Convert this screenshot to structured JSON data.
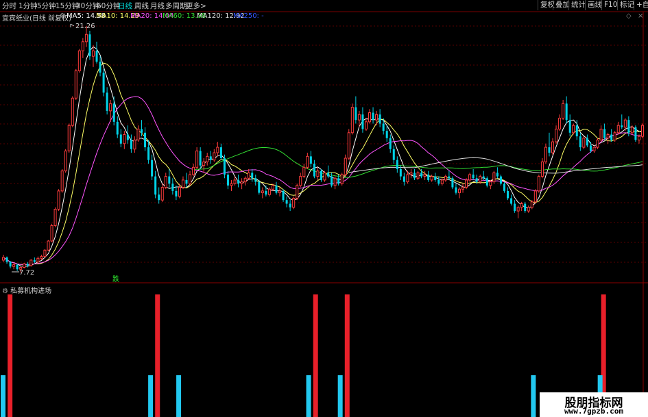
{
  "toolbar": {
    "timeframes": [
      "分时",
      "1分钟",
      "5分钟",
      "15分钟",
      "30分钟",
      "60分钟",
      "日线",
      "周线",
      "月线",
      "多周期",
      "更多>"
    ],
    "active_timeframe": "日线",
    "right_buttons": [
      "复权",
      "叠加",
      "统计",
      "画线",
      "F10",
      "标记",
      "+自选"
    ]
  },
  "stock_info": {
    "name": "宜宾纸业(日线 前复权)",
    "ma5": "MA5: 14.58",
    "ma10": "MA10: 14.29",
    "ma20": "MA20: 14.04",
    "ma60": "MA60: 13.08",
    "ma120": "MA120: 12.92",
    "ma250": "MA250: -"
  },
  "colors": {
    "up": "#ff3c3c",
    "down": "#00d2e6",
    "ma5": "#ffffff",
    "ma10": "#ffff66",
    "ma20": "#ff55ff",
    "ma60": "#33dd33",
    "ma120": "#e0e0e0",
    "ma250": "#3355ff",
    "grid": "#5a0000",
    "indicator_red": "#e8202a",
    "indicator_cyan": "#22c8f0"
  },
  "annotations": {
    "high_label": "21.26",
    "low_label": "7.72",
    "signal_text": "跌"
  },
  "indicator": {
    "title": "私募机构进场",
    "red_bar_indices": [
      1,
      43,
      88,
      97,
      170
    ],
    "cyan_bar_indices": [
      0,
      42,
      50,
      87,
      96,
      151,
      170
    ]
  },
  "watermark": {
    "title": "股朋指标网",
    "url": "www.7gpzb.com"
  },
  "chart_data": {
    "type": "candlestick",
    "y_range": [
      7.72,
      21.26
    ],
    "high_marker_index": 24,
    "low_marker_index": 5,
    "ohlc": [
      [
        8.4,
        8.7,
        8.3,
        8.55
      ],
      [
        8.55,
        8.6,
        8.2,
        8.3
      ],
      [
        8.3,
        8.35,
        7.95,
        8.05
      ],
      [
        8.05,
        8.25,
        7.9,
        8.15
      ],
      [
        8.15,
        8.2,
        7.8,
        7.9
      ],
      [
        7.9,
        8.05,
        7.72,
        8.0
      ],
      [
        8.0,
        8.25,
        7.95,
        8.2
      ],
      [
        8.2,
        8.3,
        8.0,
        8.1
      ],
      [
        8.1,
        8.45,
        8.05,
        8.4
      ],
      [
        8.4,
        8.55,
        8.25,
        8.3
      ],
      [
        8.3,
        8.6,
        8.2,
        8.5
      ],
      [
        8.5,
        8.7,
        8.4,
        8.6
      ],
      [
        8.6,
        9.0,
        8.55,
        8.95
      ],
      [
        8.95,
        9.5,
        8.9,
        9.45
      ],
      [
        9.45,
        10.4,
        9.4,
        10.3
      ],
      [
        10.3,
        11.3,
        10.2,
        11.2
      ],
      [
        11.2,
        12.3,
        11.1,
        12.2
      ],
      [
        12.2,
        13.4,
        12.1,
        13.3
      ],
      [
        13.3,
        14.5,
        13.2,
        14.4
      ],
      [
        14.4,
        15.9,
        14.3,
        15.8
      ],
      [
        15.8,
        17.4,
        15.7,
        17.3
      ],
      [
        17.3,
        18.9,
        17.2,
        18.8
      ],
      [
        18.8,
        20.0,
        18.7,
        19.9
      ],
      [
        19.9,
        20.6,
        19.5,
        20.4
      ],
      [
        20.4,
        21.26,
        20.1,
        20.8
      ],
      [
        20.8,
        21.0,
        19.4,
        19.6
      ],
      [
        19.6,
        20.2,
        19.0,
        19.9
      ],
      [
        19.9,
        20.4,
        19.2,
        19.3
      ],
      [
        19.3,
        19.6,
        18.5,
        18.7
      ],
      [
        18.7,
        18.9,
        17.4,
        17.6
      ],
      [
        17.6,
        17.9,
        16.4,
        16.6
      ],
      [
        16.6,
        17.2,
        16.0,
        17.0
      ],
      [
        17.0,
        17.4,
        15.8,
        16.0
      ],
      [
        16.0,
        16.3,
        15.1,
        15.3
      ],
      [
        15.3,
        15.6,
        14.6,
        14.8
      ],
      [
        14.8,
        15.5,
        14.5,
        15.3
      ],
      [
        15.3,
        15.8,
        14.8,
        15.0
      ],
      [
        15.0,
        15.3,
        14.3,
        14.5
      ],
      [
        14.5,
        15.2,
        14.3,
        15.0
      ],
      [
        15.0,
        15.8,
        14.9,
        15.6
      ],
      [
        15.6,
        16.1,
        15.2,
        15.4
      ],
      [
        15.4,
        15.7,
        14.4,
        14.6
      ],
      [
        14.6,
        15.0,
        13.7,
        13.9
      ],
      [
        13.9,
        14.2,
        12.8,
        13.0
      ],
      [
        13.0,
        13.3,
        11.8,
        12.0
      ],
      [
        12.0,
        12.4,
        11.5,
        11.7
      ],
      [
        11.7,
        12.6,
        11.6,
        12.4
      ],
      [
        12.4,
        13.2,
        12.3,
        13.0
      ],
      [
        13.0,
        13.4,
        12.4,
        12.6
      ],
      [
        12.6,
        12.9,
        12.0,
        12.2
      ],
      [
        12.2,
        12.5,
        11.7,
        11.9
      ],
      [
        11.9,
        12.6,
        11.8,
        12.4
      ],
      [
        12.4,
        13.0,
        12.3,
        12.8
      ],
      [
        12.8,
        13.2,
        12.4,
        12.6
      ],
      [
        12.6,
        13.3,
        12.5,
        13.1
      ],
      [
        13.1,
        13.7,
        13.0,
        13.5
      ],
      [
        13.5,
        14.6,
        13.4,
        14.4
      ],
      [
        14.4,
        14.6,
        13.4,
        13.6
      ],
      [
        13.6,
        14.0,
        13.2,
        13.8
      ],
      [
        13.8,
        14.3,
        13.6,
        14.1
      ],
      [
        14.1,
        14.4,
        13.7,
        13.9
      ],
      [
        13.9,
        14.5,
        13.8,
        14.3
      ],
      [
        14.3,
        14.9,
        14.1,
        14.6
      ],
      [
        14.6,
        14.8,
        13.9,
        14.0
      ],
      [
        14.0,
        14.2,
        12.9,
        13.1
      ],
      [
        13.1,
        13.3,
        12.3,
        12.5
      ],
      [
        12.5,
        12.8,
        12.2,
        12.6
      ],
      [
        12.6,
        13.0,
        12.5,
        12.8
      ],
      [
        12.8,
        13.1,
        12.4,
        12.6
      ],
      [
        12.6,
        12.9,
        12.3,
        12.7
      ],
      [
        12.7,
        13.0,
        12.5,
        12.9
      ],
      [
        12.9,
        13.4,
        12.8,
        13.2
      ],
      [
        13.2,
        13.4,
        12.7,
        12.9
      ],
      [
        12.9,
        13.1,
        12.5,
        12.7
      ],
      [
        12.7,
        12.8,
        12.0,
        12.1
      ],
      [
        12.1,
        12.4,
        11.8,
        12.2
      ],
      [
        12.2,
        12.5,
        11.9,
        12.0
      ],
      [
        12.0,
        12.4,
        11.9,
        12.3
      ],
      [
        12.3,
        12.6,
        12.2,
        12.5
      ],
      [
        12.5,
        12.7,
        12.0,
        12.1
      ],
      [
        12.1,
        12.4,
        11.9,
        12.2
      ],
      [
        12.2,
        12.3,
        11.6,
        11.7
      ],
      [
        11.7,
        11.9,
        11.3,
        11.5
      ],
      [
        11.5,
        11.7,
        11.1,
        11.3
      ],
      [
        11.3,
        11.9,
        11.2,
        11.8
      ],
      [
        11.8,
        12.6,
        11.7,
        12.5
      ],
      [
        12.5,
        13.2,
        12.4,
        13.0
      ],
      [
        13.0,
        13.7,
        12.9,
        13.5
      ],
      [
        13.5,
        14.3,
        13.4,
        14.1
      ],
      [
        14.1,
        14.4,
        13.5,
        13.7
      ],
      [
        13.7,
        13.9,
        12.9,
        13.0
      ],
      [
        13.0,
        13.5,
        12.8,
        13.3
      ],
      [
        13.3,
        13.4,
        12.7,
        12.8
      ],
      [
        12.8,
        13.3,
        12.7,
        13.2
      ],
      [
        13.2,
        13.6,
        12.9,
        13.0
      ],
      [
        13.0,
        13.2,
        12.4,
        12.5
      ],
      [
        12.5,
        13.0,
        12.3,
        12.9
      ],
      [
        12.9,
        13.1,
        12.5,
        12.6
      ],
      [
        12.6,
        13.2,
        12.5,
        13.1
      ],
      [
        13.1,
        14.2,
        13.0,
        14.0
      ],
      [
        14.0,
        15.6,
        13.9,
        15.4
      ],
      [
        15.4,
        17.0,
        15.3,
        16.8
      ],
      [
        16.8,
        17.4,
        15.9,
        16.1
      ],
      [
        16.1,
        16.6,
        15.7,
        16.4
      ],
      [
        16.4,
        16.8,
        15.4,
        15.6
      ],
      [
        15.6,
        16.2,
        15.5,
        16.0
      ],
      [
        16.0,
        16.7,
        15.9,
        16.5
      ],
      [
        16.5,
        16.8,
        15.9,
        16.1
      ],
      [
        16.1,
        16.6,
        15.8,
        16.4
      ],
      [
        16.4,
        16.7,
        15.7,
        15.9
      ],
      [
        15.9,
        16.2,
        15.3,
        15.5
      ],
      [
        15.5,
        15.8,
        14.9,
        15.1
      ],
      [
        15.1,
        15.3,
        14.3,
        14.5
      ],
      [
        14.5,
        14.7,
        13.7,
        13.9
      ],
      [
        13.9,
        14.1,
        13.2,
        13.4
      ],
      [
        13.4,
        13.6,
        12.8,
        13.0
      ],
      [
        13.0,
        13.2,
        12.5,
        12.7
      ],
      [
        12.7,
        13.3,
        12.6,
        13.1
      ],
      [
        13.1,
        13.4,
        12.9,
        13.2
      ],
      [
        13.2,
        13.4,
        12.8,
        12.9
      ],
      [
        12.9,
        13.3,
        12.8,
        13.2
      ],
      [
        13.2,
        13.4,
        12.9,
        13.0
      ],
      [
        13.0,
        13.3,
        12.8,
        13.1
      ],
      [
        13.1,
        13.3,
        12.7,
        12.8
      ],
      [
        12.8,
        13.1,
        12.7,
        13.0
      ],
      [
        13.0,
        13.2,
        12.7,
        12.8
      ],
      [
        12.8,
        13.0,
        12.5,
        12.6
      ],
      [
        12.6,
        12.9,
        12.5,
        12.8
      ],
      [
        12.8,
        13.1,
        12.7,
        13.0
      ],
      [
        13.0,
        13.3,
        12.8,
        12.9
      ],
      [
        12.9,
        13.0,
        12.3,
        12.4
      ],
      [
        12.4,
        12.6,
        12.0,
        12.1
      ],
      [
        12.1,
        12.4,
        11.8,
        12.3
      ],
      [
        12.3,
        12.6,
        12.1,
        12.4
      ],
      [
        12.4,
        12.9,
        12.3,
        12.8
      ],
      [
        12.8,
        13.2,
        12.7,
        13.1
      ],
      [
        13.1,
        13.4,
        12.8,
        12.9
      ],
      [
        12.9,
        13.1,
        12.6,
        12.7
      ],
      [
        12.7,
        13.1,
        12.6,
        13.0
      ],
      [
        13.0,
        13.3,
        12.8,
        12.9
      ],
      [
        12.9,
        13.0,
        12.4,
        12.5
      ],
      [
        12.5,
        12.8,
        12.3,
        12.7
      ],
      [
        12.7,
        13.3,
        12.6,
        13.2
      ],
      [
        13.2,
        13.5,
        12.9,
        13.0
      ],
      [
        13.0,
        13.1,
        12.5,
        12.6
      ],
      [
        12.6,
        12.7,
        12.1,
        12.2
      ],
      [
        12.2,
        12.4,
        11.7,
        11.8
      ],
      [
        11.8,
        12.0,
        11.4,
        11.5
      ],
      [
        11.5,
        11.7,
        11.0,
        11.1
      ],
      [
        11.1,
        11.4,
        10.7,
        11.3
      ],
      [
        11.3,
        11.6,
        11.1,
        11.5
      ],
      [
        11.5,
        11.6,
        11.0,
        11.1
      ],
      [
        11.1,
        11.4,
        11.0,
        11.3
      ],
      [
        11.3,
        11.7,
        11.2,
        11.6
      ],
      [
        11.6,
        12.3,
        11.5,
        12.2
      ],
      [
        12.2,
        13.1,
        12.1,
        13.0
      ],
      [
        13.0,
        14.0,
        12.9,
        13.8
      ],
      [
        13.8,
        14.8,
        13.7,
        14.6
      ],
      [
        14.6,
        15.4,
        14.1,
        14.3
      ],
      [
        14.3,
        15.1,
        14.2,
        14.9
      ],
      [
        14.9,
        15.8,
        14.8,
        15.6
      ],
      [
        15.6,
        16.4,
        15.5,
        16.2
      ],
      [
        16.2,
        17.2,
        16.1,
        17.0
      ],
      [
        17.0,
        17.4,
        15.9,
        16.1
      ],
      [
        16.1,
        16.4,
        15.2,
        15.4
      ],
      [
        15.4,
        15.9,
        15.3,
        15.8
      ],
      [
        15.8,
        16.1,
        15.0,
        15.2
      ],
      [
        15.2,
        15.4,
        14.4,
        14.6
      ],
      [
        14.6,
        15.2,
        14.5,
        15.1
      ],
      [
        15.1,
        15.3,
        14.6,
        14.7
      ],
      [
        14.7,
        14.9,
        14.3,
        14.4
      ],
      [
        14.4,
        14.7,
        14.3,
        14.6
      ],
      [
        14.6,
        15.1,
        14.5,
        15.0
      ],
      [
        15.0,
        15.8,
        14.9,
        15.6
      ],
      [
        15.6,
        15.9,
        15.0,
        15.1
      ],
      [
        15.1,
        15.4,
        14.8,
        15.3
      ],
      [
        15.3,
        15.6,
        14.9,
        15.0
      ],
      [
        15.0,
        15.5,
        14.9,
        15.4
      ],
      [
        15.4,
        16.0,
        15.3,
        15.8
      ],
      [
        15.8,
        16.4,
        15.6,
        15.7
      ],
      [
        15.7,
        16.2,
        15.5,
        16.1
      ],
      [
        16.1,
        16.3,
        15.2,
        15.4
      ],
      [
        15.4,
        15.8,
        15.3,
        15.7
      ],
      [
        15.7,
        15.8,
        14.9,
        15.0
      ],
      [
        15.0,
        15.3,
        14.8,
        15.2
      ],
      [
        15.2,
        15.9,
        15.1,
        15.8
      ]
    ]
  }
}
